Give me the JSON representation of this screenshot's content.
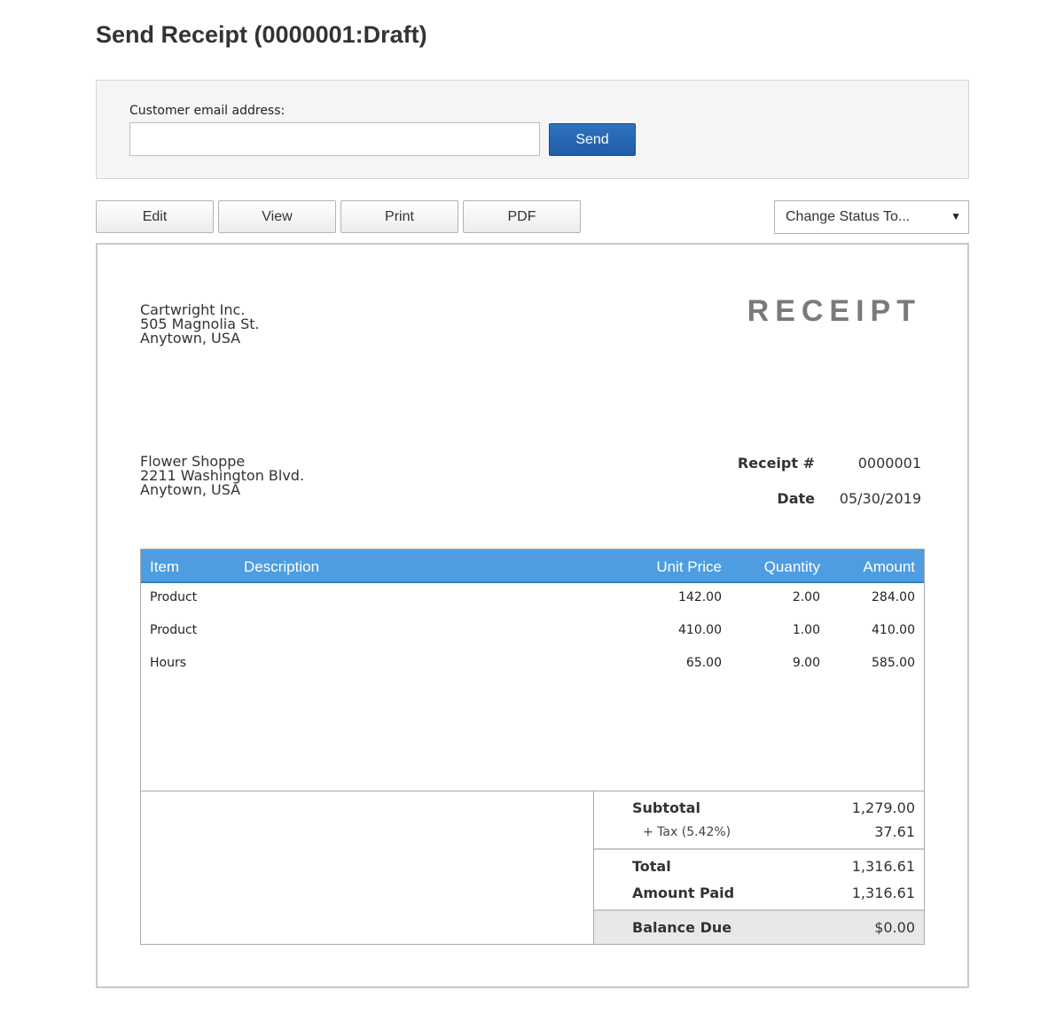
{
  "page": {
    "title": "Send Receipt (0000001:Draft)"
  },
  "send_panel": {
    "email_label": "Customer email address:",
    "email_value": "",
    "email_placeholder": "",
    "send_label": "Send"
  },
  "toolbar": {
    "edit": "Edit",
    "view": "View",
    "print": "Print",
    "pdf": "PDF",
    "status_select": "Change Status To..."
  },
  "receipt": {
    "title": "RECEIPT",
    "from": {
      "line1": "Cartwright Inc.",
      "line2": "505 Magnolia St.",
      "line3": "Anytown, USA"
    },
    "to": {
      "line1": "Flower Shoppe",
      "line2": "2211 Washington Blvd.",
      "line3": "Anytown, USA"
    },
    "number_label": "Receipt #",
    "number_value": "0000001",
    "date_label": "Date",
    "date_value": "05/30/2019",
    "columns": {
      "item": "Item",
      "description": "Description",
      "unit_price": "Unit Price",
      "quantity": "Quantity",
      "amount": "Amount"
    },
    "rows": [
      {
        "item": "Product",
        "description": "",
        "unit_price": "142.00",
        "quantity": "2.00",
        "amount": "284.00"
      },
      {
        "item": "Product",
        "description": "",
        "unit_price": "410.00",
        "quantity": "1.00",
        "amount": "410.00"
      },
      {
        "item": "Hours",
        "description": "",
        "unit_price": "65.00",
        "quantity": "9.00",
        "amount": "585.00"
      }
    ],
    "totals": {
      "subtotal_label": "Subtotal",
      "subtotal_value": "1,279.00",
      "tax_label": "+ Tax (5.42%)",
      "tax_value": "37.61",
      "total_label": "Total",
      "total_value": "1,316.61",
      "paid_label": "Amount Paid",
      "paid_value": "1,316.61",
      "balance_label": "Balance Due",
      "balance_value": "$0.00"
    }
  },
  "colors": {
    "accent_blue": "#4d9de0",
    "send_button": "#1f5ca6",
    "receipt_title": "#7a7a7a"
  },
  "icons": {
    "status_caret": "chevron-down-icon"
  }
}
